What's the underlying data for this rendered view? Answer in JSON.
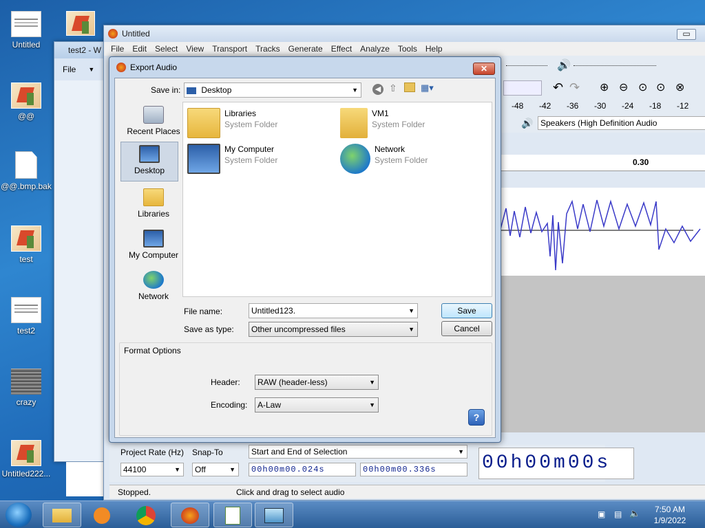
{
  "desktop": {
    "icons": [
      {
        "label": "Untitled"
      },
      {
        "label": "@@"
      },
      {
        "label": "@@.bmp.bak"
      },
      {
        "label": "test"
      },
      {
        "label": "test2"
      },
      {
        "label": "crazy"
      },
      {
        "label": "Untitled222..."
      }
    ]
  },
  "bg_window_test2": {
    "title": "test2 - W",
    "menu_file": "File"
  },
  "audacity": {
    "title": "Untitled",
    "menu": [
      "File",
      "Edit",
      "Select",
      "View",
      "Transport",
      "Tracks",
      "Generate",
      "Effect",
      "Analyze",
      "Tools",
      "Help"
    ],
    "ruler_ticks": [
      "-48",
      "-42",
      "-36",
      "-30",
      "-24",
      "-18",
      "-12"
    ],
    "output_device": "Speakers (High Definition Audio",
    "timeline_label": "0.30",
    "project_rate_label": "Project Rate (Hz)",
    "snap_to_label": "Snap-To",
    "project_rate_value": "44100",
    "snap_value": "Off",
    "selection_mode": "Start and End of Selection",
    "sel_start": "00h00m00.024s",
    "sel_end": "00h00m00.336s",
    "big_time": "00h00m00s",
    "status_left": "Stopped.",
    "status_right": "Click and drag to select audio"
  },
  "dialog": {
    "title": "Export Audio",
    "save_in_label": "Save in:",
    "save_in_value": "Desktop",
    "places": [
      {
        "label": "Recent Places",
        "icon": "recent-places-icon"
      },
      {
        "label": "Desktop",
        "icon": "desktop-icon"
      },
      {
        "label": "Libraries",
        "icon": "libraries-icon"
      },
      {
        "label": "My Computer",
        "icon": "computer-icon"
      },
      {
        "label": "Network",
        "icon": "network-icon"
      }
    ],
    "items": [
      {
        "name": "Libraries",
        "type": "System Folder"
      },
      {
        "name": "VM1",
        "type": "System Folder"
      },
      {
        "name": "My Computer",
        "type": "System Folder"
      },
      {
        "name": "Network",
        "type": "System Folder"
      }
    ],
    "file_name_label": "File name:",
    "file_name_value": "Untitled123.",
    "save_as_type_label": "Save as type:",
    "save_as_type_value": "Other uncompressed files",
    "save_button": "Save",
    "cancel_button": "Cancel",
    "format_options_label": "Format Options",
    "header_label": "Header:",
    "header_value": "RAW (header-less)",
    "encoding_label": "Encoding:",
    "encoding_value": "A-Law",
    "help_button": "?"
  },
  "taskbar": {
    "time": "7:50 AM",
    "date": "1/9/2022"
  }
}
